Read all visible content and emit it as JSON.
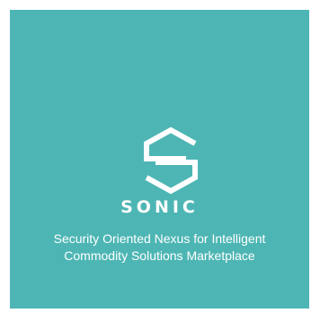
{
  "brand": {
    "name": "SONIC",
    "tagline_line1": "Security Oriented Nexus for Intelligent",
    "tagline_line2": "Commodity Solutions Marketplace",
    "logo_icon": "hexagon-s-icon"
  },
  "colors": {
    "background": "#4db6b4",
    "foreground": "#ffffff"
  }
}
